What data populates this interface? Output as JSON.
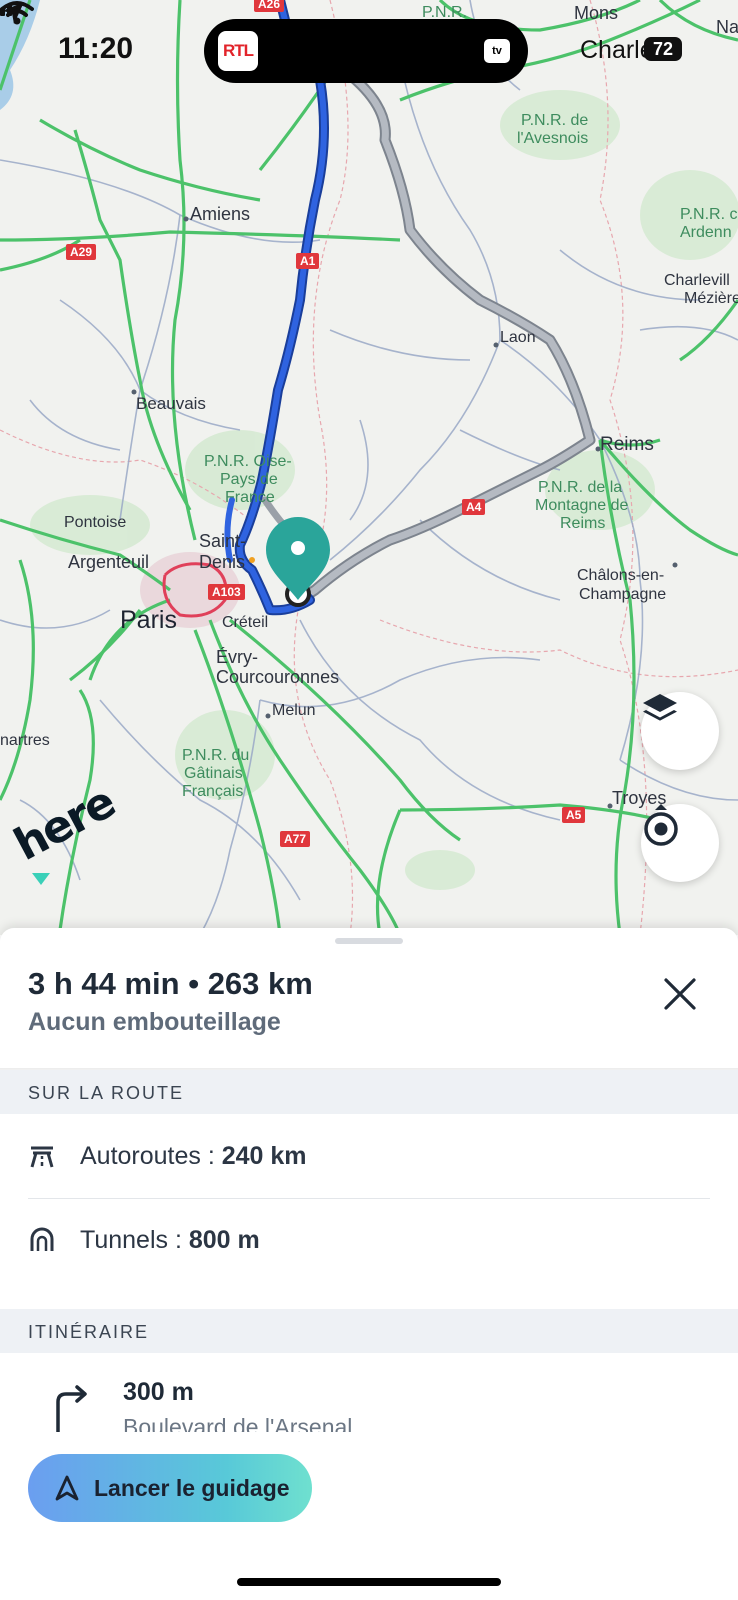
{
  "status_bar": {
    "time": "11:20",
    "live_activity_app": "RTL",
    "live_activity_icon": "apple-tv-icon",
    "live_activity_tv": "tv",
    "carrier": "Charle",
    "battery": "72"
  },
  "map": {
    "labels": {
      "amiens": "Amiens",
      "beauvais": "Beauvais",
      "laon": "Laon",
      "reims": "Reims",
      "pontoise": "Pontoise",
      "argenteuil": "Argenteuil",
      "saint_denis_1": "Saint-",
      "saint_denis_2": "Denis",
      "paris": "Paris",
      "creteil": "Créteil",
      "evry_1": "Évry-",
      "evry_2": "Courcouronnes",
      "melun": "Melun",
      "chalons_1": "Châlons-en-",
      "chalons_2": "Champagne",
      "troyes": "Troyes",
      "chartres": "nartres",
      "mons": "Mons",
      "na": "Na",
      "charleville_1": "Charlevill",
      "charleville_2": "Mézière",
      "pnr_top": "P.N.R.",
      "pnr_avesnois_1": "P.N.R. de",
      "pnr_avesnois_2": "l'Avesnois",
      "pnr_ardennes_1": "P.N.R. c",
      "pnr_ardennes_2": "Ardenn",
      "pnr_oise_1": "P.N.R. Oise-",
      "pnr_oise_2": "Pays de",
      "pnr_oise_3": "France",
      "pnr_reims_1": "P.N.R. de la",
      "pnr_reims_2": "Montagne de",
      "pnr_reims_3": "Reims",
      "pnr_gatinais_1": "P.N.R. du",
      "pnr_gatinais_2": "Gâtinais",
      "pnr_gatinais_3": "Français"
    },
    "road_shields": {
      "a26": "A26",
      "a29": "A29",
      "a1": "A1",
      "a4": "A4",
      "a103": "A103",
      "a77": "A77",
      "a5": "A5"
    },
    "logo": "here",
    "colors": {
      "main_route": "#2a5bd7",
      "alt_route": "#9ea4ad",
      "highway": "#4cc26a",
      "destination_pin": "#2aa59a"
    }
  },
  "summary": {
    "duration_distance": "3 h 44 min • 263 km",
    "traffic": "Aucun embouteillage"
  },
  "on_route": {
    "header": "SUR LA ROUTE",
    "items": [
      {
        "label": "Autoroutes : ",
        "value": "240 km",
        "icon": "highway-icon"
      },
      {
        "label": "Tunnels : ",
        "value": "800 m",
        "icon": "tunnel-icon"
      }
    ]
  },
  "itinerary": {
    "header": "ITINÉRAIRE",
    "first_step": {
      "distance": "300 m",
      "street": "Boulevard de l'Arsenal",
      "icon": "turn-right-icon"
    }
  },
  "actions": {
    "start_guidance": "Lancer le guidage"
  }
}
